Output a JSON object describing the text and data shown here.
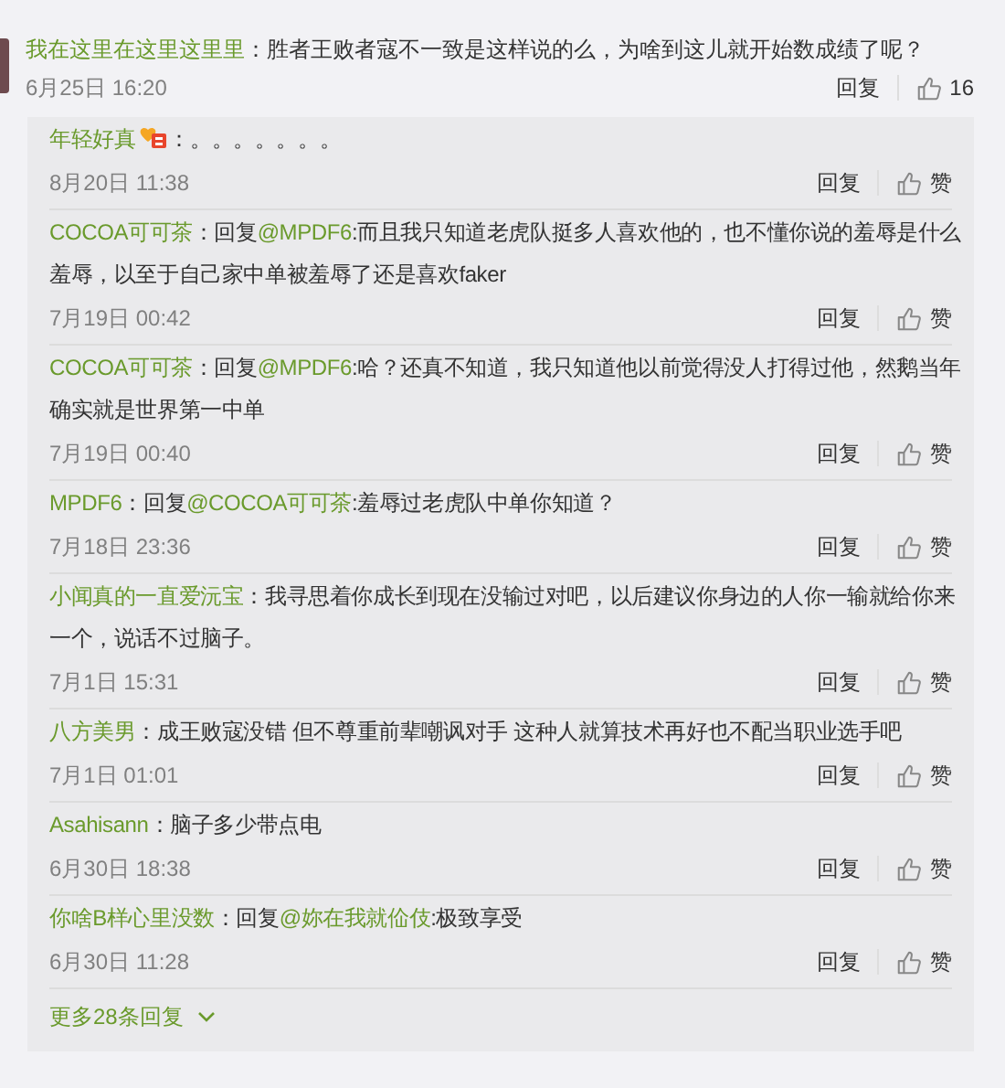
{
  "comment": {
    "user": "我在这里在这里这里里",
    "text": "：胜者王败者寇不一致是这样说的么，为啥到这儿就开始数成绩了呢？",
    "time": "6月25日 16:20",
    "reply_label": "回复",
    "likes": "16"
  },
  "replies": [
    {
      "user": "年轻好真",
      "badge": true,
      "text": "：。。。。。。。",
      "time": "8月20日 11:38",
      "reply_label": "回复",
      "like_label": "赞"
    },
    {
      "user": "COCOA可可茶",
      "prefix": "：回复",
      "mention": "@MPDF6",
      "text": ":而且我只知道老虎队挺多人喜欢他的，也不懂你说的羞辱是什么羞辱，以至于自己家中单被羞辱了还是喜欢faker",
      "time": "7月19日 00:42",
      "reply_label": "回复",
      "like_label": "赞"
    },
    {
      "user": "COCOA可可茶",
      "prefix": "：回复",
      "mention": "@MPDF6",
      "text": ":哈？还真不知道，我只知道他以前觉得没人打得过他，然鹅当年确实就是世界第一中单",
      "time": "7月19日 00:40",
      "reply_label": "回复",
      "like_label": "赞"
    },
    {
      "user": "MPDF6",
      "prefix": "：回复",
      "mention": "@COCOA可可茶",
      "text": ":羞辱过老虎队中单你知道？",
      "time": "7月18日 23:36",
      "reply_label": "回复",
      "like_label": "赞"
    },
    {
      "user": "小闻真的一直爱沅宝",
      "text": "：我寻思着你成长到现在没输过对吧，以后建议你身边的人你一输就给你来一个，说话不过脑子。",
      "time": "7月1日 15:31",
      "reply_label": "回复",
      "like_label": "赞"
    },
    {
      "user": "八方美男",
      "text": "：成王败寇没错 但不尊重前辈嘲讽对手 这种人就算技术再好也不配当职业选手吧",
      "time": "7月1日 01:01",
      "reply_label": "回复",
      "like_label": "赞"
    },
    {
      "user": "Asahisann",
      "text": "：脑子多少带点电",
      "time": "6月30日 18:38",
      "reply_label": "回复",
      "like_label": "赞"
    },
    {
      "user": "你啥B样心里没数",
      "prefix": "：回复",
      "mention": "@妳在我就佡伎",
      "text": ":极致享受",
      "time": "6月30日 11:28",
      "reply_label": "回复",
      "like_label": "赞"
    }
  ],
  "more_replies": "更多28条回复"
}
